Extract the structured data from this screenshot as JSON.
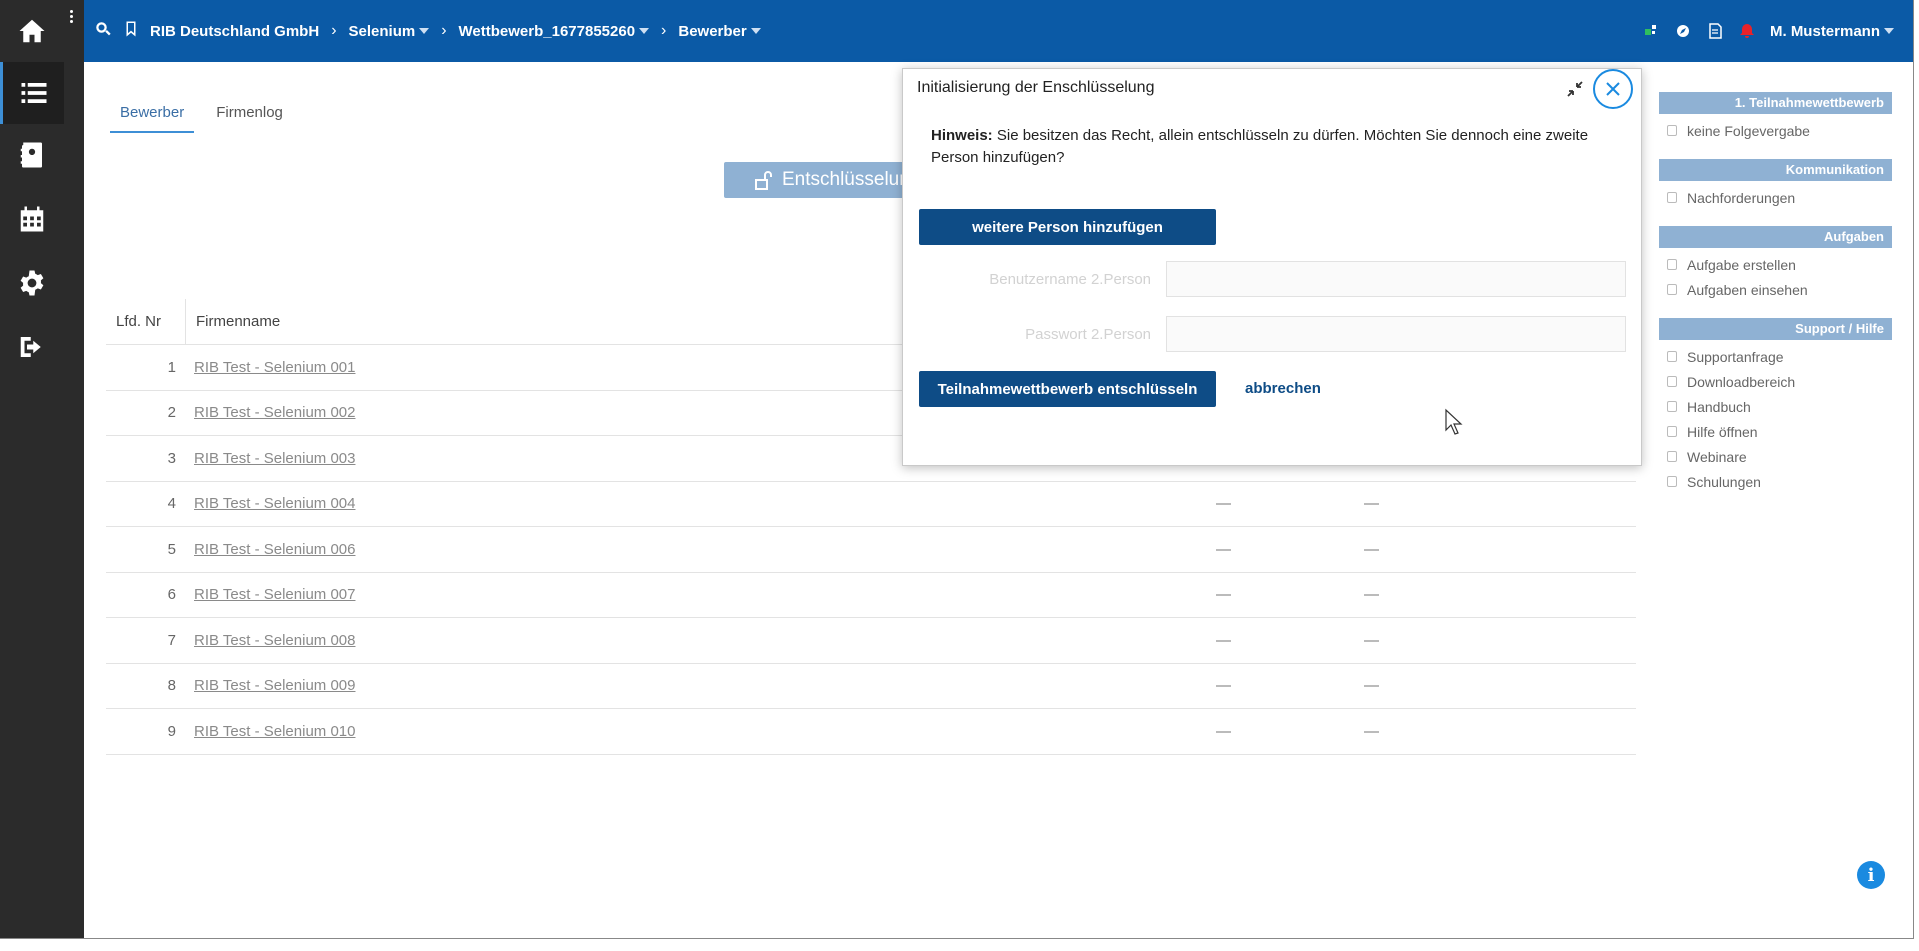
{
  "topbar": {
    "breadcrumbs": [
      {
        "label": "RIB Deutschland GmbH",
        "dropdown": false
      },
      {
        "label": "Selenium",
        "dropdown": true
      },
      {
        "label": "Wettbewerb_1677855260",
        "dropdown": true
      },
      {
        "label": "Bewerber",
        "dropdown": true
      }
    ],
    "user_name": "M. Mustermann",
    "color": "#0b5aa6"
  },
  "sidebar": {
    "items": [
      {
        "icon": "home-icon"
      },
      {
        "icon": "list-icon",
        "active": true
      },
      {
        "icon": "contacts-icon"
      },
      {
        "icon": "calendar-icon"
      },
      {
        "icon": "gear-icon"
      },
      {
        "icon": "logout-icon"
      }
    ]
  },
  "main": {
    "tabs": [
      {
        "label": "Bewerber",
        "active": true
      },
      {
        "label": "Firmenlog",
        "active": false
      }
    ],
    "decrypt_button_label": "Entschlüsselung",
    "table": {
      "headers": [
        "Lfd. Nr",
        "Firmenname"
      ],
      "rows": [
        {
          "nr": "1",
          "name": "RIB Test - Selenium 001",
          "d1": "",
          "d2": ""
        },
        {
          "nr": "2",
          "name": "RIB Test - Selenium 002",
          "d1": "",
          "d2": ""
        },
        {
          "nr": "3",
          "name": "RIB Test - Selenium 003",
          "d1": "",
          "d2": ""
        },
        {
          "nr": "4",
          "name": "RIB Test - Selenium 004",
          "d1": "—",
          "d2": "—"
        },
        {
          "nr": "5",
          "name": "RIB Test - Selenium 006",
          "d1": "—",
          "d2": "—"
        },
        {
          "nr": "6",
          "name": "RIB Test - Selenium 007",
          "d1": "—",
          "d2": "—"
        },
        {
          "nr": "7",
          "name": "RIB Test - Selenium 008",
          "d1": "—",
          "d2": "—"
        },
        {
          "nr": "8",
          "name": "RIB Test - Selenium 009",
          "d1": "—",
          "d2": "—"
        },
        {
          "nr": "9",
          "name": "RIB Test - Selenium 010",
          "d1": "—",
          "d2": "—"
        }
      ]
    }
  },
  "right_panel": {
    "groups": [
      {
        "title": "1. Teilnahmewettbewerb",
        "items": [
          "keine Folgevergabe"
        ]
      },
      {
        "title": "Kommunikation",
        "items": [
          "Nachforderungen"
        ]
      },
      {
        "title": "Aufgaben",
        "items": [
          "Aufgabe erstellen",
          "Aufgaben einsehen"
        ]
      },
      {
        "title": "Support / Hilfe",
        "items": [
          "Supportanfrage",
          "Downloadbereich",
          "Handbuch",
          "Hilfe öffnen",
          "Webinare",
          "Schulungen"
        ]
      }
    ]
  },
  "modal": {
    "title": "Initialisierung der Enschlüsselung",
    "hint_label": "Hinweis:",
    "hint_text": "Sie besitzen das Recht, allein entschlüsseln zu dürfen. Möchten Sie dennoch eine zweite Person hinzufügen?",
    "add_person_label": "weitere Person hinzufügen",
    "username_label": "Benutzername 2.Person",
    "password_label": "Passwort 2.Person",
    "username_value": "",
    "password_value": "",
    "decrypt_label": "Teilnahmewettbewerb entschlüsseln",
    "cancel_label": "abbrechen"
  },
  "colors": {
    "primary": "#0b5aa6",
    "button_dark": "#0e4c86",
    "panel_header": "#8fb1d3",
    "sidebar": "#2b2b2b"
  }
}
